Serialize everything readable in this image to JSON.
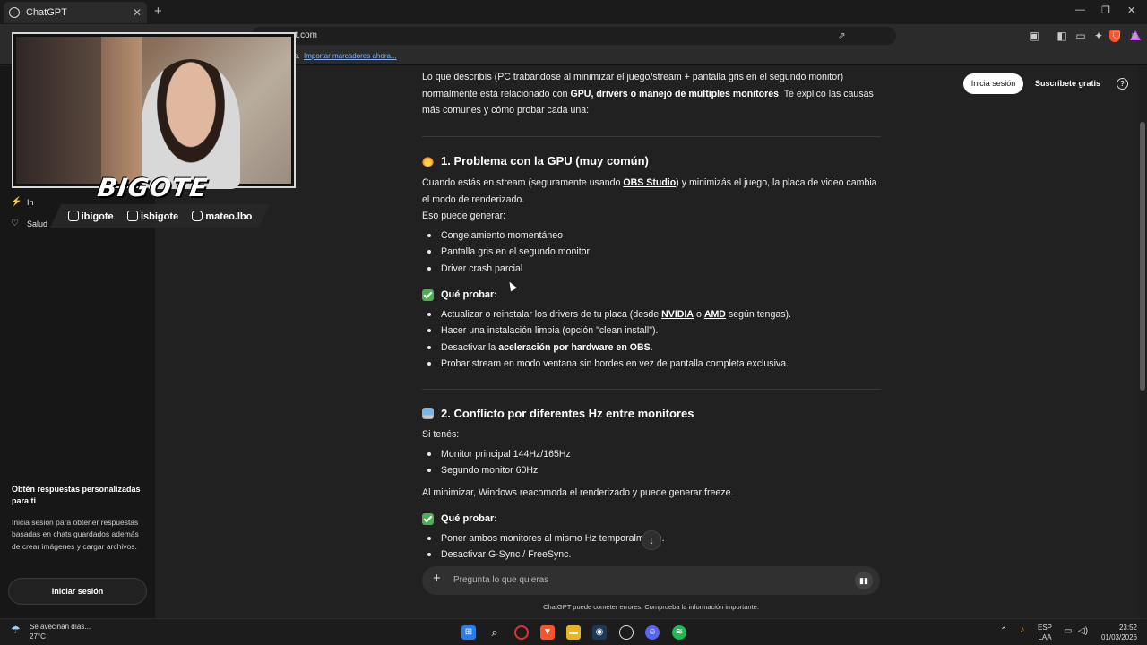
{
  "browser": {
    "tab_title": "ChatGPT",
    "url": "pt.com",
    "bookmark_text": "es.",
    "bookmark_link": "Importar marcadores ahora..."
  },
  "sidebar": {
    "items": [
      {
        "icon": "pulse-icon",
        "label": "In"
      },
      {
        "icon": "heart-icon",
        "label": "Salud"
      }
    ],
    "promo_title": "Obtén respuestas personalizadas para ti",
    "promo_text": "Inicia sesión para obtener respuestas basadas en chats guardados además de crear imágenes y cargar archivos.",
    "login_button": "Iniciar sesión"
  },
  "header": {
    "login": "Inicia sesión",
    "subscribe": "Suscríbete gratis",
    "help": "?"
  },
  "article": {
    "intro_1": "Lo que describís (PC trabándose al minimizar el juego/stream + pantalla gris en el segundo monitor) normalmente está relacionado con ",
    "intro_bold": "GPU, drivers o manejo de múltiples monitores",
    "intro_2": ". Te explico las causas más comunes y cómo probar cada una:",
    "s1_title": "1. Problema con la GPU (muy común)",
    "s1_p1_a": "Cuando estás en stream (seguramente usando ",
    "s1_p1_link": "OBS Studio",
    "s1_p1_b": ") y minimizás el juego, la placa de video cambia el modo de renderizado.",
    "s1_p2": "Eso puede generar:",
    "s1_list": [
      "Congelamiento momentáneo",
      "Pantalla gris en el segundo monitor",
      "Driver crash parcial"
    ],
    "test_heading": "Qué probar:",
    "s1_t1_a": "Actualizar o reinstalar los drivers de tu placa (desde ",
    "s1_t1_l1": "NVIDIA",
    "s1_t1_mid": " o ",
    "s1_t1_l2": "AMD",
    "s1_t1_b": " según tengas).",
    "s1_t2": "Hacer una instalación limpia (opción \"clean install\").",
    "s1_t3_a": "Desactivar la ",
    "s1_t3_bold": "aceleración por hardware en OBS",
    "s1_t3_b": ".",
    "s1_t4": "Probar stream en modo ventana sin bordes en vez de pantalla completa exclusiva.",
    "s2_title": "2. Conflicto por diferentes Hz entre monitores",
    "s2_p1": "Si tenés:",
    "s2_list": [
      "Monitor principal 144Hz/165Hz",
      "Segundo monitor 60Hz"
    ],
    "s2_p2": "Al minimizar, Windows reacomoda el renderizado y puede generar freeze.",
    "s2_t1": "Poner ambos monitores al mismo Hz temporalm",
    "s2_t1_end": "e.",
    "s2_t2": "Desactivar G-Sync / FreeSync."
  },
  "composer": {
    "placeholder": "Pregunta lo que quieras",
    "disclaimer": "ChatGPT puede cometer errores. Comprueba la información importante."
  },
  "overlay": {
    "name": "BIGOTE",
    "twitch_kick": "ibigote",
    "tiktok": "isbigote",
    "instagram": "mateo.lbo"
  },
  "taskbar": {
    "weather_text": "Se avecinan días...",
    "temperature": "27°C",
    "lang_1": "ESP",
    "lang_2": "LAA",
    "time": "23:52",
    "date": "01/03/2026"
  },
  "colors": {
    "background": "#212121",
    "sidebar": "#171717",
    "brave": "#fb542b"
  }
}
